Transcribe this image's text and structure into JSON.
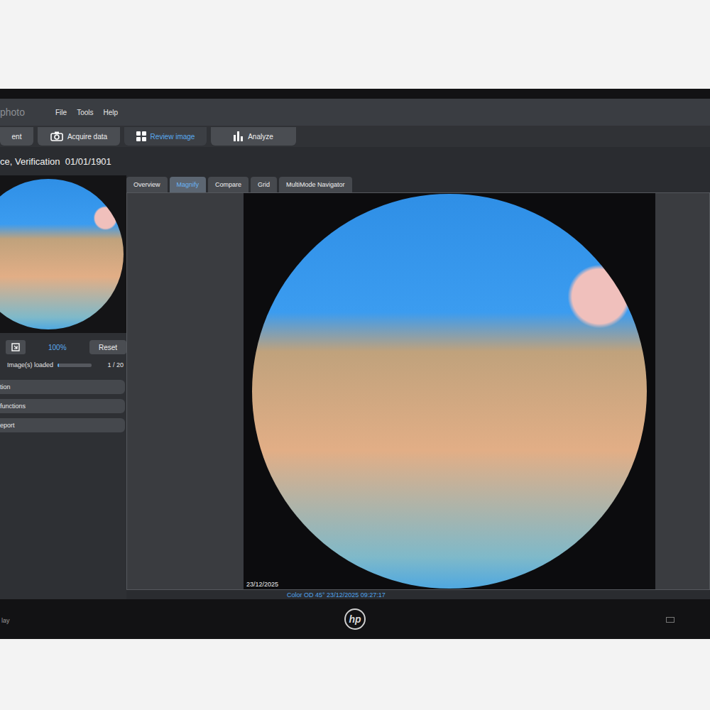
{
  "app": {
    "title": "photo"
  },
  "menu": [
    "File",
    "Tools",
    "Help"
  ],
  "toolbar": [
    {
      "label": "ent",
      "selected": false,
      "icon": "none"
    },
    {
      "label": "Acquire data",
      "selected": false,
      "icon": "camera"
    },
    {
      "label": "Review image",
      "selected": true,
      "icon": "grid"
    },
    {
      "label": "Analyze",
      "selected": false,
      "icon": "chart"
    }
  ],
  "patient": {
    "title": "ce, Verification  01/01/1901"
  },
  "zoom": {
    "value": "100%",
    "reset": "Reset"
  },
  "loading": {
    "label": "Image(s) loaded",
    "level": 0.05,
    "count": "1 / 20"
  },
  "panels": [
    "tion",
    "functions",
    "eport"
  ],
  "view_tabs": [
    {
      "label": "Overview",
      "selected": false
    },
    {
      "label": "Magnify",
      "selected": true
    },
    {
      "label": "Compare",
      "selected": false
    },
    {
      "label": "Grid",
      "selected": false
    },
    {
      "label": "MultiMode Navigator",
      "selected": false
    }
  ],
  "image": {
    "date": "23/12/2025",
    "caption": "Color OD 45° 23/12/2025 09:27:17"
  },
  "monitor": {
    "brand": "hp"
  },
  "taskbar": {
    "text": "lay"
  }
}
